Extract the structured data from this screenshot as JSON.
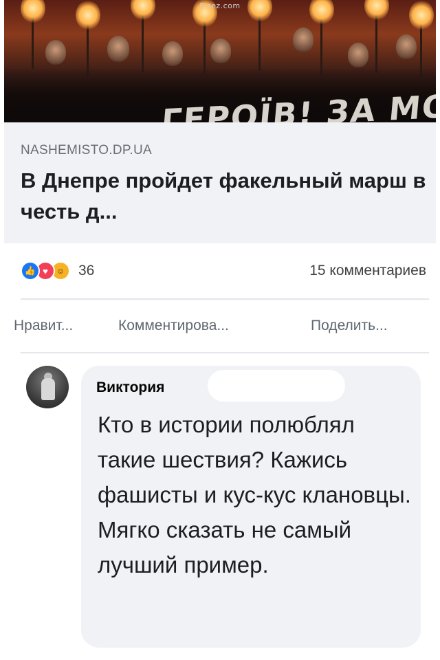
{
  "watermark": "Pisez.com",
  "link_preview": {
    "banner_text": "ГЕРОЇВ! ЗА МО",
    "domain": "NASHEMISTO.DP.UA",
    "title": "В Днепре пройдет факельный марш в честь д..."
  },
  "reactions": {
    "icons": [
      "like-icon",
      "love-icon",
      "haha-icon"
    ],
    "count": "36",
    "comments": "15 комментариев"
  },
  "actions": {
    "like": "Нравит...",
    "comment": "Комментирова...",
    "share": "Поделить..."
  },
  "comment": {
    "author": "Виктория",
    "text": "Кто в истории полюблял такие шествия? Кажись фашисты и кус-кус клановцы. Мягко сказать не самый лучший пример."
  },
  "colors": {
    "like": "#1877f2",
    "love": "#f33e58",
    "haha": "#f7b125",
    "bubble": "#f0f2f5"
  }
}
